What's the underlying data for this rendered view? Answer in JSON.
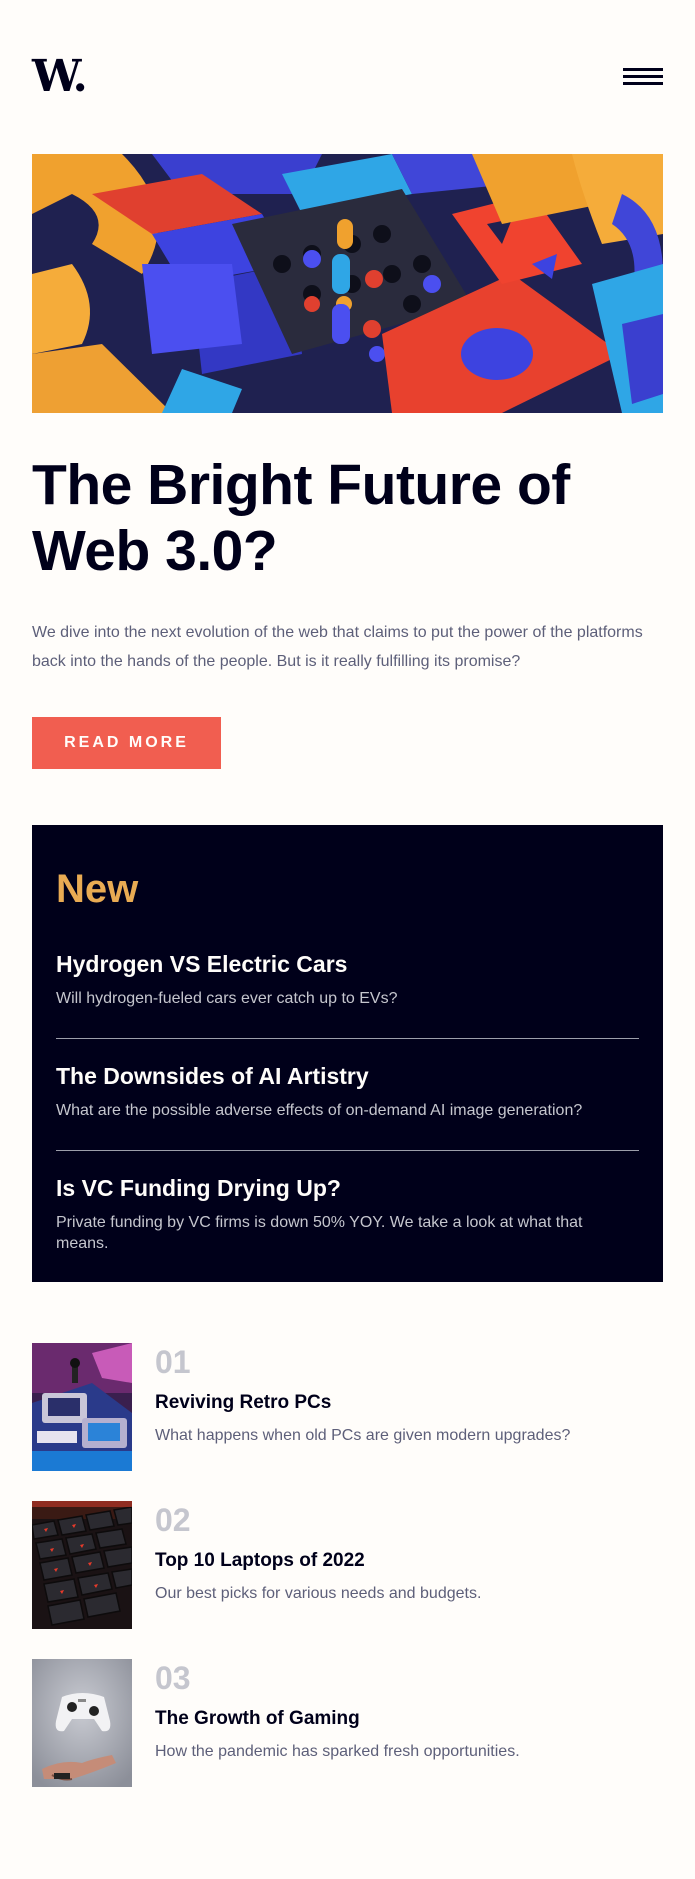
{
  "header": {
    "logo": "W.",
    "menu_icon": "hamburger-menu-icon"
  },
  "hero": {
    "image_icon": "abstract-3d-blocks-image",
    "title_line1": "The Bright Future of",
    "title_line2": "Web 3.0?",
    "description": "We dive into the next evolution of the web that claims to put the power of the platforms back into the hands of the people. But is it really fulfilling its promise?",
    "button_label": "READ MORE"
  },
  "new_section": {
    "heading": "New",
    "items": [
      {
        "title": "Hydrogen VS Electric Cars",
        "description": "Will hydrogen-fueled cars ever catch up to EVs?"
      },
      {
        "title": "The Downsides of AI Artistry",
        "description": "What are the possible adverse effects of on-demand AI image generation?"
      },
      {
        "title": "Is VC Funding Drying Up?",
        "description": "Private funding by VC firms is down 50% YOY. We take a look at what that means."
      }
    ]
  },
  "articles": [
    {
      "number": "01",
      "title": "Reviving Retro PCs",
      "description": "What happens when old PCs are given modern upgrades?",
      "image_icon": "retro-pc-image"
    },
    {
      "number": "02",
      "title": "Top 10 Laptops of 2022",
      "description": "Our best picks for various needs and budgets.",
      "image_icon": "laptop-keyboard-image"
    },
    {
      "number": "03",
      "title": "The Growth of Gaming",
      "description": "How the pandemic has sparked fresh opportunities.",
      "image_icon": "game-controller-image"
    }
  ],
  "colors": {
    "background": "#fffdfa",
    "dark_navy": "#00001a",
    "accent_red": "#f15e50",
    "accent_orange": "#e9ab53",
    "grayish_blue": "#5d5f79",
    "grayish_light": "#c5c6ce"
  }
}
